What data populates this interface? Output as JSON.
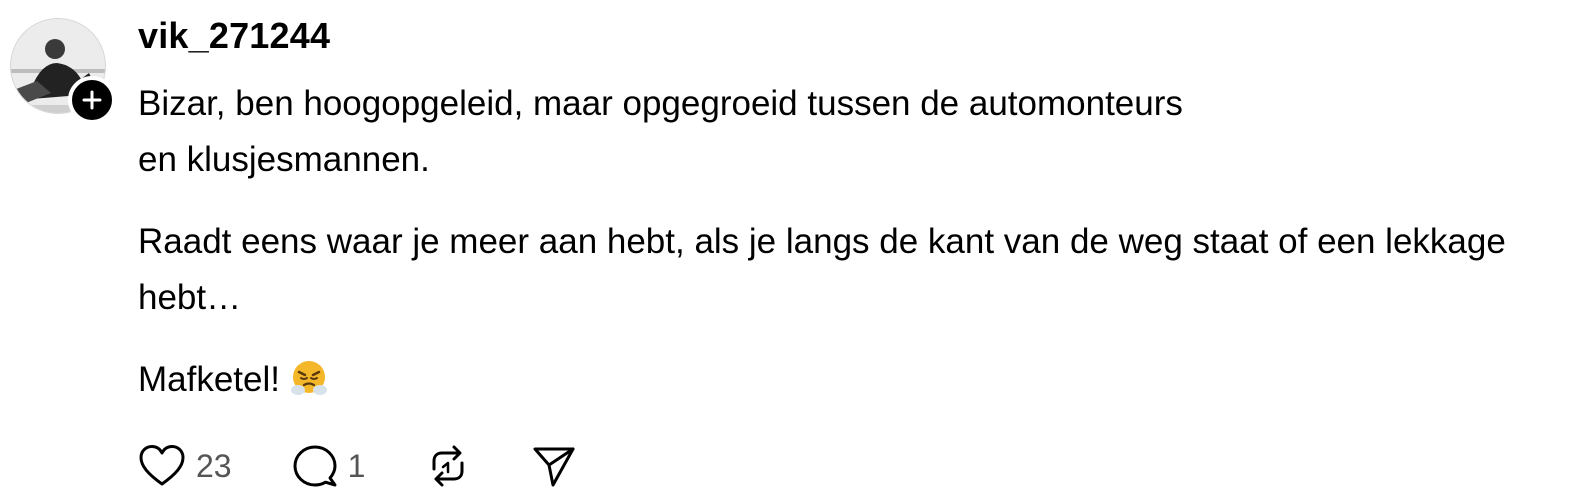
{
  "post": {
    "username": "vik_271244",
    "paragraphs": [
      "Bizar, ben hoogopgeleid, maar opgegroeid tussen de automonteurs\nen klusjesmannen.",
      "Raadt eens waar je meer aan hebt, als je langs de kant van de weg staat of een lekkage hebt…"
    ],
    "last_line": "Mafketel!",
    "emoji": "face-with-steam-from-nose",
    "icons": {
      "follow": "plus-icon",
      "like": "heart-icon",
      "reply": "comment-icon",
      "repost": "repost-icon",
      "share": "send-icon"
    }
  },
  "actions": {
    "likes": "23",
    "replies": "1"
  },
  "colors": {
    "text": "#000000",
    "muted": "#555555",
    "badge": "#000000",
    "emoji": "#f5b72a"
  }
}
